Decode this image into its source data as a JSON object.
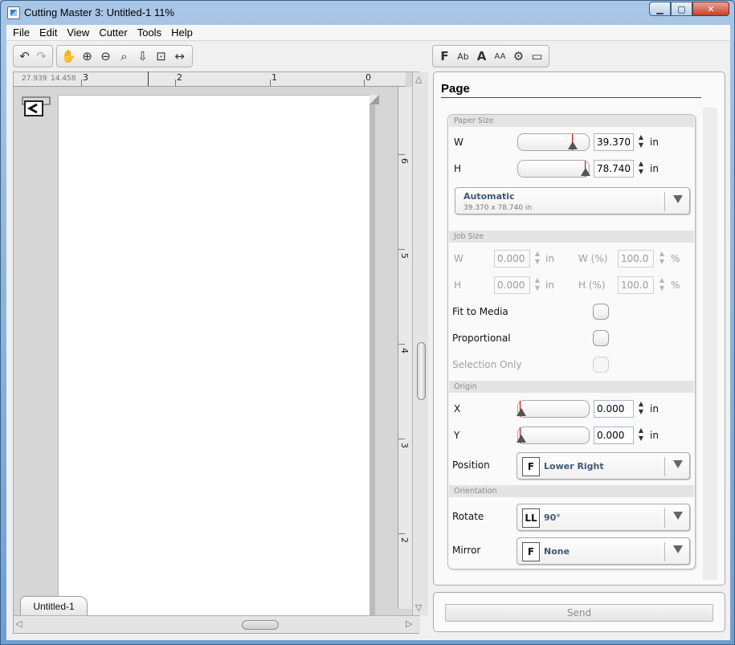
{
  "window": {
    "title": "Cutting Master 3: Untitled-1 11%"
  },
  "menu": [
    "File",
    "Edit",
    "View",
    "Cutter",
    "Tools",
    "Help"
  ],
  "toolbar": {
    "undo_icon": "undo-icon",
    "redo_icon": "redo-icon",
    "pan_icon": "hand-icon",
    "zoom_in_icon": "zoom-in-icon",
    "zoom_out_icon": "zoom-out-icon",
    "zoom_selection_icon": "zoom-selection-icon",
    "zoom_page_icon": "zoom-page-icon",
    "fit_all_icon": "fit-all-icon",
    "fit_width_icon": "fit-width-icon"
  },
  "panel_tabs": [
    "page-tab",
    "text-tab",
    "font-tab",
    "font-size-tab",
    "settings-tab",
    "cutter-tab"
  ],
  "panel_tab_text": {
    "text": "Ab",
    "size": "AA"
  },
  "ruler": {
    "coord_x": "27.939",
    "coord_y": "14.458",
    "top_labels": [
      "3",
      "2",
      "1",
      "0"
    ],
    "right_labels": [
      "6",
      "5",
      "4",
      "3",
      "2"
    ]
  },
  "document": {
    "tab_label": "Untitled-1"
  },
  "page_panel": {
    "title": "Page",
    "paper_size": {
      "header": "Paper Size",
      "w_label": "W",
      "w_value": "39.370",
      "h_label": "H",
      "h_value": "78.740",
      "unit": "in",
      "preset": "Automatic",
      "preset_detail": "39.370 x 78.740 in",
      "w_slider_fraction": 0.8,
      "h_slider_fraction": 1.0
    },
    "job_size": {
      "header": "Job Size",
      "w_label": "W",
      "w_value": "0.000",
      "h_label": "H",
      "h_value": "0.000",
      "unit": "in",
      "wpct_label": "W (%)",
      "wpct_value": "100.0",
      "hpct_label": "H (%)",
      "hpct_value": "100.0",
      "pct_unit": "%",
      "fit_to_media": "Fit to Media",
      "proportional": "Proportional",
      "selection_only": "Selection Only"
    },
    "origin": {
      "header": "Origin",
      "x_label": "X",
      "x_value": "0.000",
      "y_label": "Y",
      "y_value": "0.000",
      "unit": "in",
      "position_label": "Position",
      "position_value": "Lower Right",
      "position_icon": "F"
    },
    "orientation": {
      "header": "Orientation",
      "rotate_label": "Rotate",
      "rotate_value": "90°",
      "rotate_icon": "LL",
      "mirror_label": "Mirror",
      "mirror_value": "None",
      "mirror_icon": "F"
    }
  },
  "send_button": "Send"
}
